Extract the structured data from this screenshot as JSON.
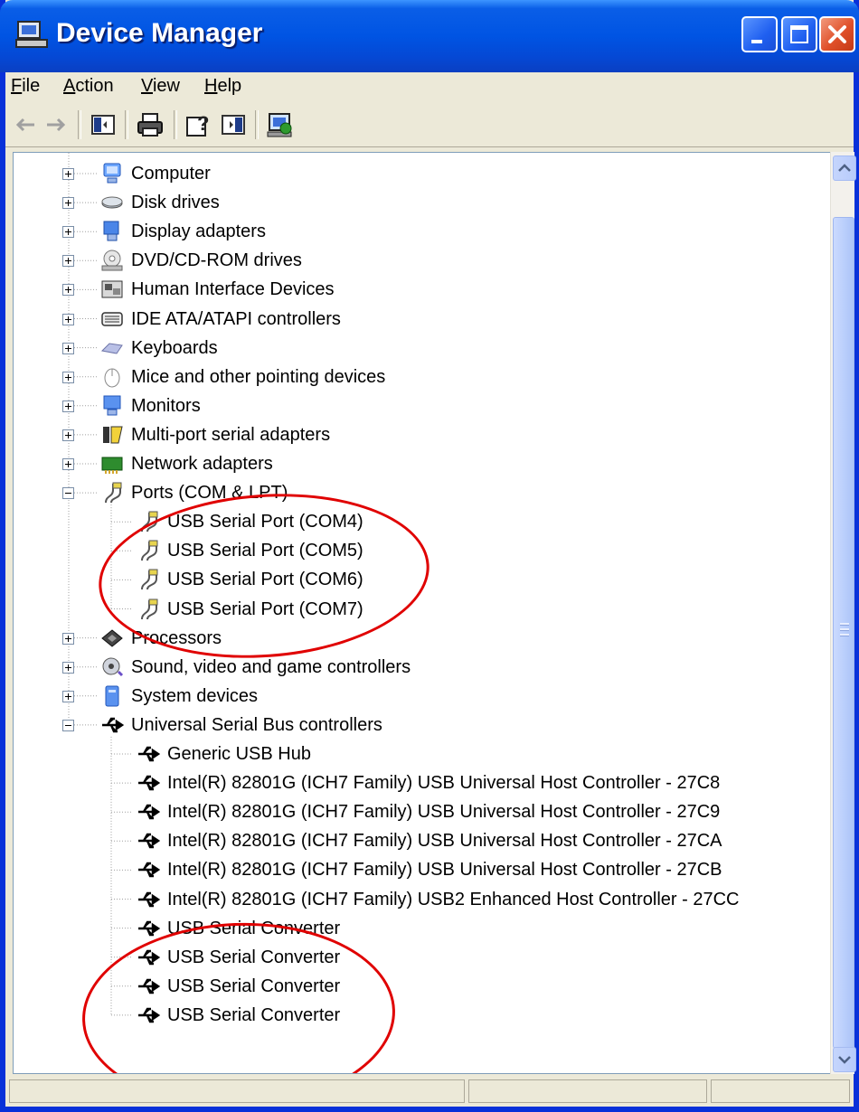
{
  "window": {
    "title": "Device Manager",
    "menu": [
      {
        "label": "File",
        "key": "F",
        "rest": "ile"
      },
      {
        "label": "Action",
        "key": "A",
        "rest": "ction"
      },
      {
        "label": "View",
        "key": "V",
        "rest": "iew"
      },
      {
        "label": "Help",
        "key": "H",
        "rest": "elp"
      }
    ]
  },
  "tree": {
    "categories": [
      {
        "label": "Computer",
        "icon": "computer-icon",
        "expanded": false
      },
      {
        "label": "Disk drives",
        "icon": "disk-drive-icon",
        "expanded": false
      },
      {
        "label": "Display adapters",
        "icon": "display-adapter-icon",
        "expanded": false
      },
      {
        "label": "DVD/CD-ROM drives",
        "icon": "cdrom-icon",
        "expanded": false
      },
      {
        "label": "Human Interface Devices",
        "icon": "hid-icon",
        "expanded": false
      },
      {
        "label": "IDE ATA/ATAPI controllers",
        "icon": "ide-controller-icon",
        "expanded": false
      },
      {
        "label": "Keyboards",
        "icon": "keyboard-icon",
        "expanded": false
      },
      {
        "label": "Mice and other pointing devices",
        "icon": "mouse-icon",
        "expanded": false
      },
      {
        "label": "Monitors",
        "icon": "monitor-icon",
        "expanded": false
      },
      {
        "label": "Multi-port serial adapters",
        "icon": "multiport-serial-icon",
        "expanded": false
      },
      {
        "label": "Network adapters",
        "icon": "network-adapter-icon",
        "expanded": false
      },
      {
        "label": "Ports (COM & LPT)",
        "icon": "port-icon",
        "expanded": true,
        "children": [
          "USB Serial Port (COM4)",
          "USB Serial Port (COM5)",
          "USB Serial Port (COM6)",
          "USB Serial Port (COM7)"
        ]
      },
      {
        "label": "Processors",
        "icon": "processor-icon",
        "expanded": false
      },
      {
        "label": "Sound, video and game controllers",
        "icon": "sound-icon",
        "expanded": false
      },
      {
        "label": "System devices",
        "icon": "system-devices-icon",
        "expanded": false
      },
      {
        "label": "Universal Serial Bus controllers",
        "icon": "usb-icon",
        "expanded": true,
        "children": [
          "Generic USB Hub",
          "Intel(R) 82801G (ICH7 Family) USB Universal Host Controller - 27C8",
          "Intel(R) 82801G (ICH7 Family) USB Universal Host Controller - 27C9",
          "Intel(R) 82801G (ICH7 Family) USB Universal Host Controller - 27CA",
          "Intel(R) 82801G (ICH7 Family) USB Universal Host Controller - 27CB",
          "Intel(R) 82801G (ICH7 Family) USB2 Enhanced Host Controller - 27CC",
          "USB Serial Converter",
          "USB Serial Converter",
          "USB Serial Converter",
          "USB Serial Converter"
        ]
      }
    ]
  },
  "annotations": {
    "color": "#e00000",
    "description": "red ellipses highlighting USB serial ports and USB serial converters"
  },
  "colors": {
    "titlebar": "#0054e3",
    "window_bg": "#ece9d8",
    "tree_bg": "#ffffff"
  }
}
